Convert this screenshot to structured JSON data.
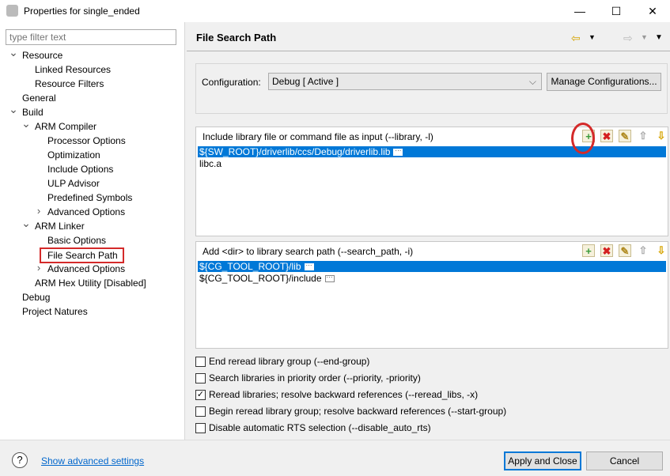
{
  "window": {
    "title": "Properties for single_ended",
    "minimize": "—",
    "maximize": "☐",
    "close": "✕"
  },
  "filter": {
    "placeholder": "type filter text"
  },
  "tree": [
    {
      "label": "Resource",
      "level": 0,
      "expand": "open"
    },
    {
      "label": "Linked Resources",
      "level": 1
    },
    {
      "label": "Resource Filters",
      "level": 1
    },
    {
      "label": "General",
      "level": 0
    },
    {
      "label": "Build",
      "level": 0,
      "expand": "open"
    },
    {
      "label": "ARM Compiler",
      "level": 1,
      "expand": "open"
    },
    {
      "label": "Processor Options",
      "level": 2
    },
    {
      "label": "Optimization",
      "level": 2
    },
    {
      "label": "Include Options",
      "level": 2
    },
    {
      "label": "ULP Advisor",
      "level": 2
    },
    {
      "label": "Predefined Symbols",
      "level": 2
    },
    {
      "label": "Advanced Options",
      "level": 2,
      "expand": "closed"
    },
    {
      "label": "ARM Linker",
      "level": 1,
      "expand": "open"
    },
    {
      "label": "Basic Options",
      "level": 2
    },
    {
      "label": "File Search Path",
      "level": 2,
      "selected": true
    },
    {
      "label": "Advanced Options",
      "level": 2,
      "expand": "closed"
    },
    {
      "label": "ARM Hex Utility  [Disabled]",
      "level": 1
    },
    {
      "label": "Debug",
      "level": 0
    },
    {
      "label": "Project Natures",
      "level": 0
    }
  ],
  "page": {
    "title": "File Search Path"
  },
  "config": {
    "label": "Configuration:",
    "value": "Debug  [ Active ]",
    "manage": "Manage Configurations..."
  },
  "library": {
    "label": "Include library file or command file as input (--library, -l)",
    "items": [
      {
        "text": "${SW_ROOT}/driverlib/ccs/Debug/driverlib.lib",
        "selected": true
      },
      {
        "text": "libc.a"
      }
    ]
  },
  "search": {
    "label": "Add <dir> to library search path (--search_path, -i)",
    "items": [
      {
        "text": "${CG_TOOL_ROOT}/lib",
        "selected": true,
        "dots": true
      },
      {
        "text": "${CG_TOOL_ROOT}/include",
        "dots": true
      }
    ]
  },
  "checkboxes": [
    {
      "label": "End reread library group (--end-group)",
      "checked": false
    },
    {
      "label": "Search libraries in priority order (--priority, -priority)",
      "checked": false
    },
    {
      "label": "Reread libraries; resolve backward references (--reread_libs, -x)",
      "checked": true
    },
    {
      "label": "Begin reread library group; resolve backward references (--start-group)",
      "checked": false
    },
    {
      "label": "Disable automatic RTS selection (--disable_auto_rts)",
      "checked": false
    }
  ],
  "footer": {
    "help": "?",
    "advanced": "Show advanced settings",
    "apply": "Apply and Close",
    "cancel": "Cancel"
  },
  "colors": {
    "selection": "#0078d7",
    "highlight_ring": "#d42a2a",
    "link": "#0066cc"
  }
}
